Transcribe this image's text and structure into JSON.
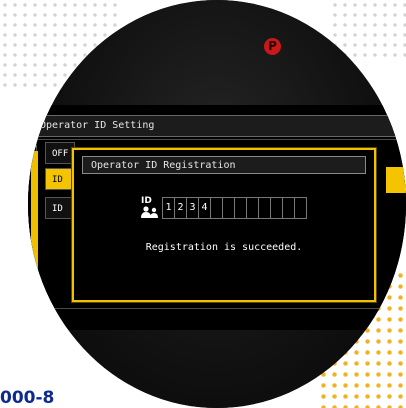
{
  "panel": {
    "header": "Operator ID Setting",
    "indicator": "P",
    "list_items": [
      {
        "label": "OFF"
      },
      {
        "label": "ID"
      },
      {
        "label": "ID"
      }
    ]
  },
  "dialog": {
    "title": "Operator ID Registration",
    "id_icon_label": "ID",
    "id_digits": [
      "1",
      "2",
      "3",
      "4",
      "",
      "",
      "",
      "",
      "",
      "",
      "",
      ""
    ],
    "message": "Registration is succeeded."
  },
  "page": {
    "code_fragment": "000-8"
  },
  "colors": {
    "highlight": "#f5c400",
    "indicator_red": "#c81818",
    "code_blue": "#0d2a8c",
    "dots_gold": "#f3b11e"
  },
  "scroll_icons": {
    "up": "triangle-up-icon",
    "down": "triangle-down-icon"
  }
}
